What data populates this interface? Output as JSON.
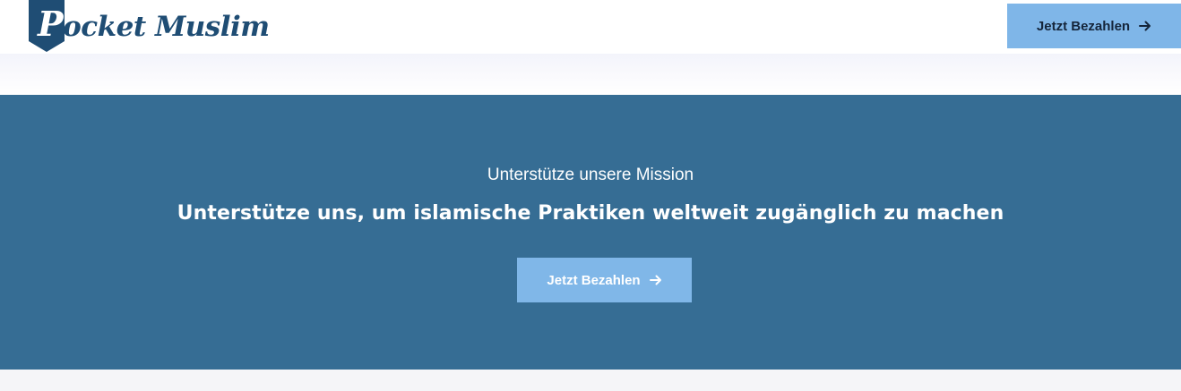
{
  "header": {
    "logo_text_first": "P",
    "logo_text_rest": "ocket Muslim",
    "cta_label": "Jetzt Bezahlen",
    "cta_icon": "arrow-right-icon"
  },
  "mission": {
    "subtitle": "Unterstütze unsere Mission",
    "title": "Unterstütze uns, um islamische Praktiken weltweit zugänglich zu machen",
    "cta_label": "Jetzt Bezahlen",
    "cta_icon": "arrow-right-icon"
  },
  "colors": {
    "brand_dark": "#1f4d74",
    "section_background": "#366d94",
    "button_accent": "#80b7e8"
  }
}
